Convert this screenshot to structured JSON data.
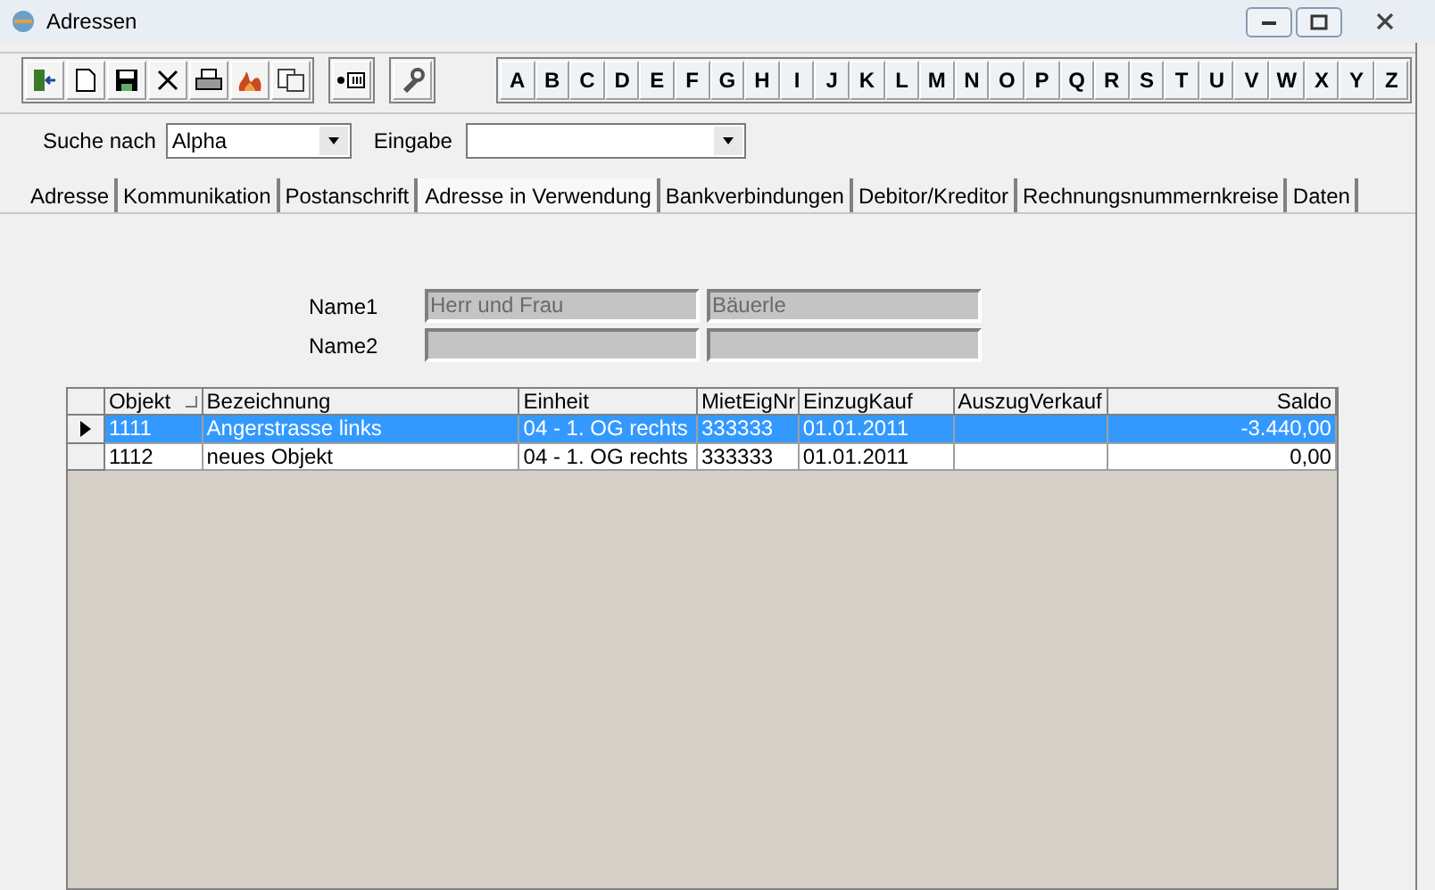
{
  "window": {
    "title": "Adressen"
  },
  "letters": [
    "A",
    "B",
    "C",
    "D",
    "E",
    "F",
    "G",
    "H",
    "I",
    "J",
    "K",
    "L",
    "M",
    "N",
    "O",
    "P",
    "Q",
    "R",
    "S",
    "T",
    "U",
    "V",
    "W",
    "X",
    "Y",
    "Z"
  ],
  "search": {
    "label": "Suche nach",
    "value": "Alpha",
    "input_label": "Eingabe"
  },
  "tabs": [
    {
      "label": "Adresse",
      "selected": false
    },
    {
      "label": "Kommunikation",
      "selected": false
    },
    {
      "label": "Postanschrift",
      "selected": false
    },
    {
      "label": "Adresse in Verwendung",
      "selected": true
    },
    {
      "label": "Bankverbindungen",
      "selected": false
    },
    {
      "label": "Debitor/Kreditor",
      "selected": false
    },
    {
      "label": "Rechnungsnummernkreise",
      "selected": false
    },
    {
      "label": "Daten",
      "selected": false
    }
  ],
  "names": [
    {
      "label": "Name1",
      "first": "Herr und Frau",
      "last": "Bäuerle",
      "disabled": true
    },
    {
      "label": "Name2",
      "disabled": true
    }
  ],
  "table": {
    "columns": [
      "Objekt",
      "Bezeichnung",
      "Einheit",
      "MietEigNr",
      "EinzugKauf",
      "AuszugVerkauf",
      "Saldo"
    ],
    "rows": [
      {
        "cells": [
          "1111",
          "Angerstrasse links",
          "04 - 1. OG rechts",
          "333333",
          "01.01.2011",
          "",
          "-3.440,00"
        ],
        "selected": true
      },
      {
        "cells": [
          "1112",
          "neues Objekt",
          "04 - 1. OG rechts",
          "333333",
          "01.01.2011",
          "",
          "0,00"
        ],
        "selected": false
      }
    ]
  }
}
